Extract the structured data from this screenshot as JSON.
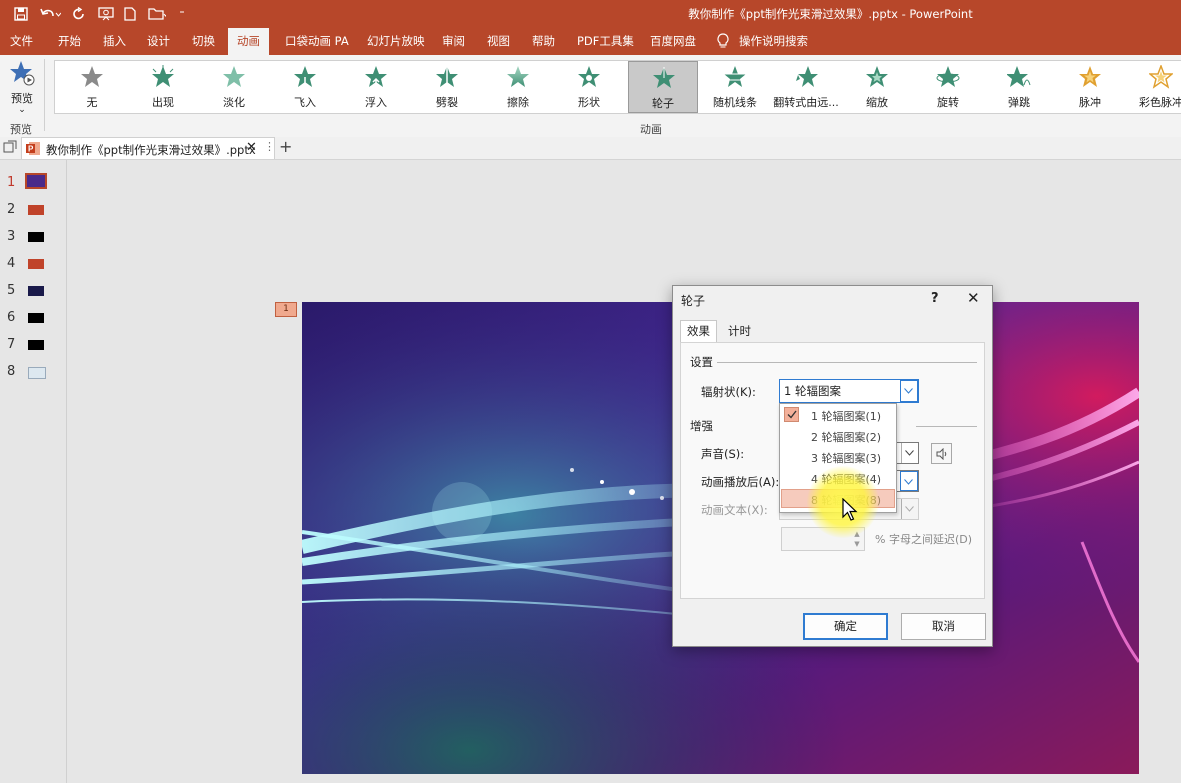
{
  "window": {
    "title": "教你制作《ppt制作光束滑过效果》.pptx  -  PowerPoint"
  },
  "menu": {
    "tabs": [
      "文件",
      "开始",
      "插入",
      "设计",
      "切换",
      "动画",
      "口袋动画 PA",
      "幻灯片放映",
      "审阅",
      "视图",
      "帮助",
      "PDF工具集",
      "百度网盘"
    ],
    "active": "动画",
    "search": "操作说明搜索"
  },
  "ribbon": {
    "preview_label": "预览",
    "preview_group": "预览",
    "animation_group": "动画",
    "animations": [
      "无",
      "出现",
      "淡化",
      "飞入",
      "浮入",
      "劈裂",
      "擦除",
      "形状",
      "轮子",
      "随机线条",
      "翻转式由远...",
      "缩放",
      "旋转",
      "弹跳",
      "脉冲",
      "彩色脉冲"
    ],
    "selected": "轮子"
  },
  "doc_tab": {
    "name": "教你制作《ppt制作光束滑过效果》.pptx"
  },
  "slides": {
    "numbers": [
      "1",
      "2",
      "3",
      "4",
      "5",
      "6",
      "7",
      "8"
    ],
    "active": "1"
  },
  "slide_marker": "1",
  "dialog": {
    "title": "轮子",
    "help": "?",
    "tabs": [
      "效果",
      "计时"
    ],
    "active_tab": "效果",
    "settings_section": "设置",
    "spokes_label": "辐射状(K):",
    "spokes_value": "1 轮辐图案",
    "options": [
      "1 轮辐图案(1)",
      "2 轮辐图案(2)",
      "3 轮辐图案(3)",
      "4 轮辐图案(4)",
      "8 轮辐图案(8)"
    ],
    "selected_option": "1 轮辐图案(1)",
    "hover_option": "8 轮辐图案(8)",
    "enhance_section": "增强",
    "sound_label": "声音(S):",
    "after_label": "动画播放后(A):",
    "text_label": "动画文本(X):",
    "delay_label": "% 字母之间延迟(D)",
    "ok": "确定",
    "cancel": "取消"
  },
  "colors": {
    "accent": "#b7472a",
    "ribbon_bg": "#f3f3f3",
    "star_green": "#3f8f74",
    "star_gold": "#e0a030"
  },
  "icons": {
    "title_bar": [
      "save-icon",
      "undo-icon",
      "redo-icon",
      "slideshow-icon",
      "new-file-icon",
      "open-folder-icon",
      "customize-icon"
    ]
  }
}
